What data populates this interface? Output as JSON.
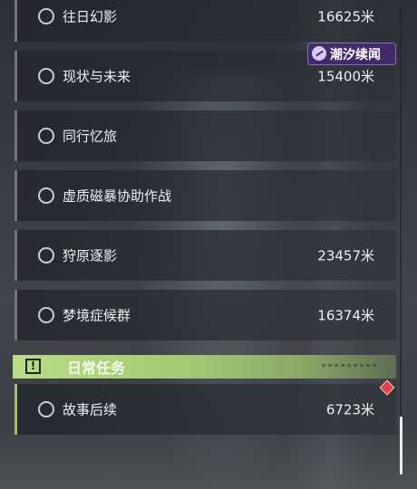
{
  "watermark": {
    "text": "潮汐续闻"
  },
  "main_quests": [
    {
      "label": "往日幻影",
      "distance": "16625米"
    },
    {
      "label": "现状与未来",
      "distance": "15400米"
    },
    {
      "label": "同行忆旅",
      "distance": ""
    },
    {
      "label": "虚质磁暴协助作战",
      "distance": ""
    },
    {
      "label": "狩原逐影",
      "distance": "23457米"
    },
    {
      "label": "梦境症候群",
      "distance": "16374米"
    }
  ],
  "daily_section": {
    "title": "日常任务",
    "icon": "exclamation-icon",
    "accent_color": "#a3c974"
  },
  "daily_quests": [
    {
      "label": "故事后续",
      "distance": "6723米",
      "badge": "red-diamond-icon"
    }
  ]
}
